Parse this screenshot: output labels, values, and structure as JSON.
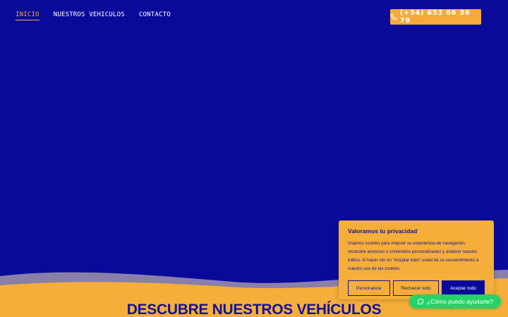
{
  "nav": {
    "items": [
      {
        "label": "INICIO",
        "active": true
      },
      {
        "label": "NUESTROS VEHICULOS",
        "active": false
      },
      {
        "label": "CONTACTO",
        "active": false
      }
    ]
  },
  "phone": {
    "label": "(+34) 653 66 36 79",
    "icon": "phone-icon"
  },
  "section": {
    "title": "DESCUBRE NUESTROS VEHÍCULOS"
  },
  "cookie": {
    "title": "Valoramos tu privacidad",
    "text": "Usamos cookies para mejorar su experiencia de navegación, mostrarle anuncios o contenidos personalizados y analizar nuestro tráfico. Al hacer clic en \"Aceptar todo\" usted da su consentimiento a nuestro uso de las cookies.",
    "buttons": {
      "customize": "Personalizar",
      "reject": "Rechazar todo",
      "accept": "Aceptar todo"
    }
  },
  "whatsapp": {
    "label": "¿Cómo puedo ayudarte?",
    "icon": "whatsapp-icon"
  },
  "colors": {
    "primary": "#0a0a9a",
    "accent": "#f6ae3a",
    "whatsapp": "#25d366"
  }
}
